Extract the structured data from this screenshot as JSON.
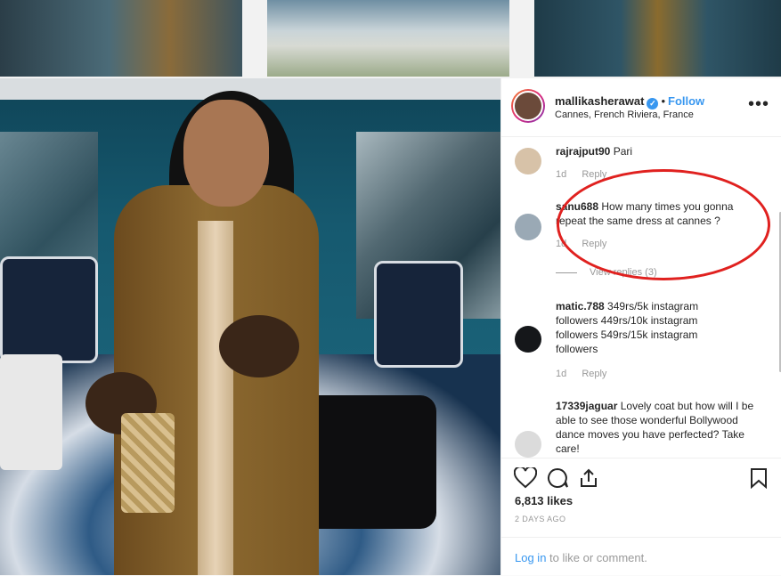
{
  "post": {
    "username": "mallikasherawat",
    "follow_label": "Follow",
    "location": "Cannes, French Riviera, France",
    "more_label": "•••"
  },
  "comments": [
    {
      "user": "rajrajput90",
      "text": "Pari",
      "age": "1d",
      "reply": "Reply"
    },
    {
      "user": "sanu688",
      "text": "How many times you gonna repeat the same dress at cannes ?",
      "age": "1d",
      "reply": "Reply",
      "view_replies": "View replies (3)"
    },
    {
      "user": "matic.788",
      "text": "349rs/5k instagram followers 449rs/10k instagram followers 549rs/15k instagram followers",
      "age": "1d",
      "reply": "Reply"
    },
    {
      "user": "17339jaguar",
      "text": "Lovely coat but how will I be able to see those wonderful Bollywood dance moves you have perfected? Take care!"
    }
  ],
  "actions": {
    "likes": "6,813 likes",
    "time": "2 DAYS AGO",
    "login_link": "Log in",
    "login_suffix": " to like or comment."
  },
  "icons": [
    "heart-icon",
    "comment-icon",
    "share-icon",
    "bookmark-icon",
    "verified-icon",
    "more-icon"
  ],
  "colors": {
    "link": "#3897f0",
    "annotation": "#e0211f",
    "text": "#262626",
    "muted": "#999999"
  }
}
